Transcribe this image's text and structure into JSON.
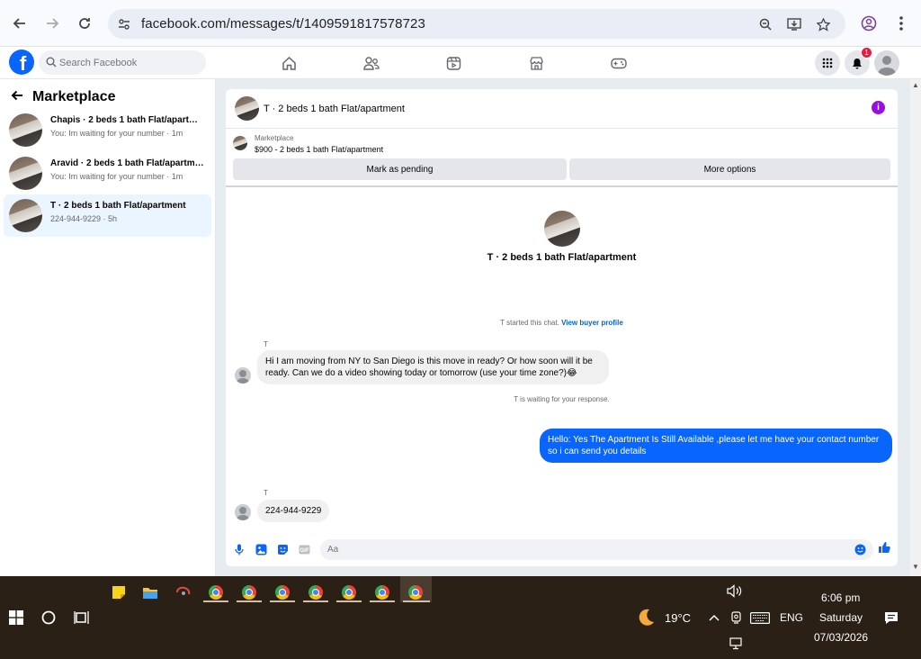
{
  "browser": {
    "url": "facebook.com/messages/t/1409591817578723",
    "icons": [
      "back-icon",
      "forward-icon",
      "reload-icon",
      "site-settings-icon",
      "zoom-icon",
      "install-icon",
      "star-icon",
      "profile-icon",
      "menu-icon"
    ]
  },
  "fb": {
    "search_placeholder": "Search Facebook",
    "notification_count": "1",
    "brand_color": "#0866ff"
  },
  "sidebar": {
    "title": "Marketplace",
    "conversations": [
      {
        "name": "Chapis · 2 beds 1 bath Flat/apartm…",
        "preview": "You: Im waiting for your number · 1m"
      },
      {
        "name": "Aravid · 2 beds 1 bath Flat/apartm…",
        "preview": "You: Im waiting for your number · 1m"
      },
      {
        "name": "T · 2 beds 1 bath Flat/apartment",
        "preview": "224-944-9229 · 5h"
      }
    ]
  },
  "chat": {
    "title": "T · 2 beds 1 bath Flat/apartment",
    "listing_label": "Marketplace",
    "listing_price": "$900 - 2 beds 1 bath Flat/apartment",
    "mark_pending": "Mark as pending",
    "more_options": "More options",
    "profile_name": "T · 2 beds 1 bath Flat/apartment",
    "started_note": "T started this chat.",
    "view_buyer": "View buyer profile",
    "sender1": "T",
    "msg1": "Hi I am moving from NY to San Diego is this move in ready? Or how soon will it be ready. Can we do a video showing today or tomorrow (use your time zone?)😂",
    "waiting_note": "T is waiting for your response.",
    "msg2": "Hello: Yes The Apartment Is Still Available ,please let me have your contact number so i can send you details",
    "sender2": "T",
    "msg3": "224-944-9229",
    "composer_placeholder": "Aa"
  },
  "taskbar": {
    "weather": "19°C",
    "language": "ENG",
    "time": "6:06 pm",
    "day": "Saturday",
    "date": "07/03/2026"
  }
}
